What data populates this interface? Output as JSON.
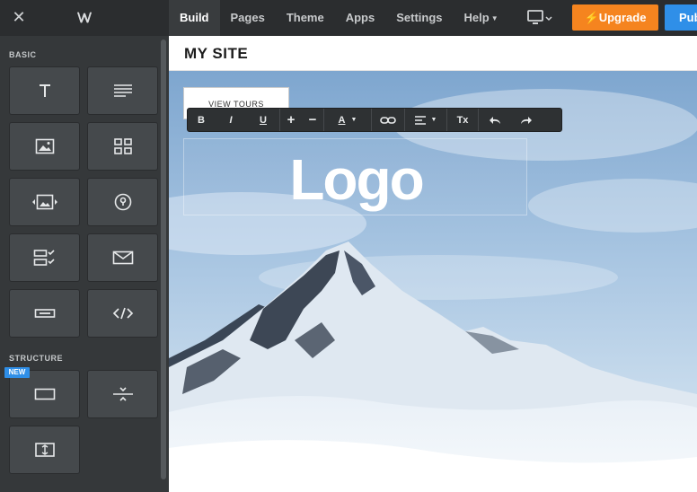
{
  "app": {
    "close_icon": "close-icon",
    "logo_icon": "weebly-w-icon"
  },
  "nav": {
    "items": [
      {
        "label": "Build",
        "active": true
      },
      {
        "label": "Pages"
      },
      {
        "label": "Theme"
      },
      {
        "label": "Apps"
      },
      {
        "label": "Settings"
      },
      {
        "label": "Help"
      }
    ],
    "device_icon": "desktop-monitor-icon",
    "upgrade_label": "Upgrade",
    "upgrade_icon": "lightning-bolt-icon",
    "publish_label": "Pub",
    "colors": {
      "upgrade": "#f5841f",
      "publish": "#2f8fe8"
    }
  },
  "sidebar": {
    "basic_label": "BASIC",
    "structure_label": "STRUCTURE",
    "new_badge": "NEW",
    "basic_tiles": [
      {
        "icon": "title-text-icon"
      },
      {
        "icon": "paragraph-text-icon"
      },
      {
        "icon": "image-icon"
      },
      {
        "icon": "gallery-grid-icon"
      },
      {
        "icon": "slideshow-icon"
      },
      {
        "icon": "map-pin-icon"
      },
      {
        "icon": "contact-form-icon"
      },
      {
        "icon": "newsletter-mail-icon"
      },
      {
        "icon": "button-icon"
      },
      {
        "icon": "embed-code-icon"
      }
    ],
    "structure_tiles": [
      {
        "icon": "section-icon"
      },
      {
        "icon": "divider-icon"
      },
      {
        "icon": "spacer-icon"
      }
    ]
  },
  "site": {
    "title": "MY SITE",
    "button_label": "VIEW TOURS",
    "logo_text": "Logo"
  },
  "toolbar": {
    "bold": "B",
    "italic": "I",
    "underline": "U",
    "increase": "+",
    "decrease": "−",
    "font_color": "A",
    "link_icon": "link-icon",
    "align_icon": "align-left-icon",
    "clear_format": "Tx",
    "undo_icon": "undo-icon",
    "redo_icon": "redo-icon"
  }
}
